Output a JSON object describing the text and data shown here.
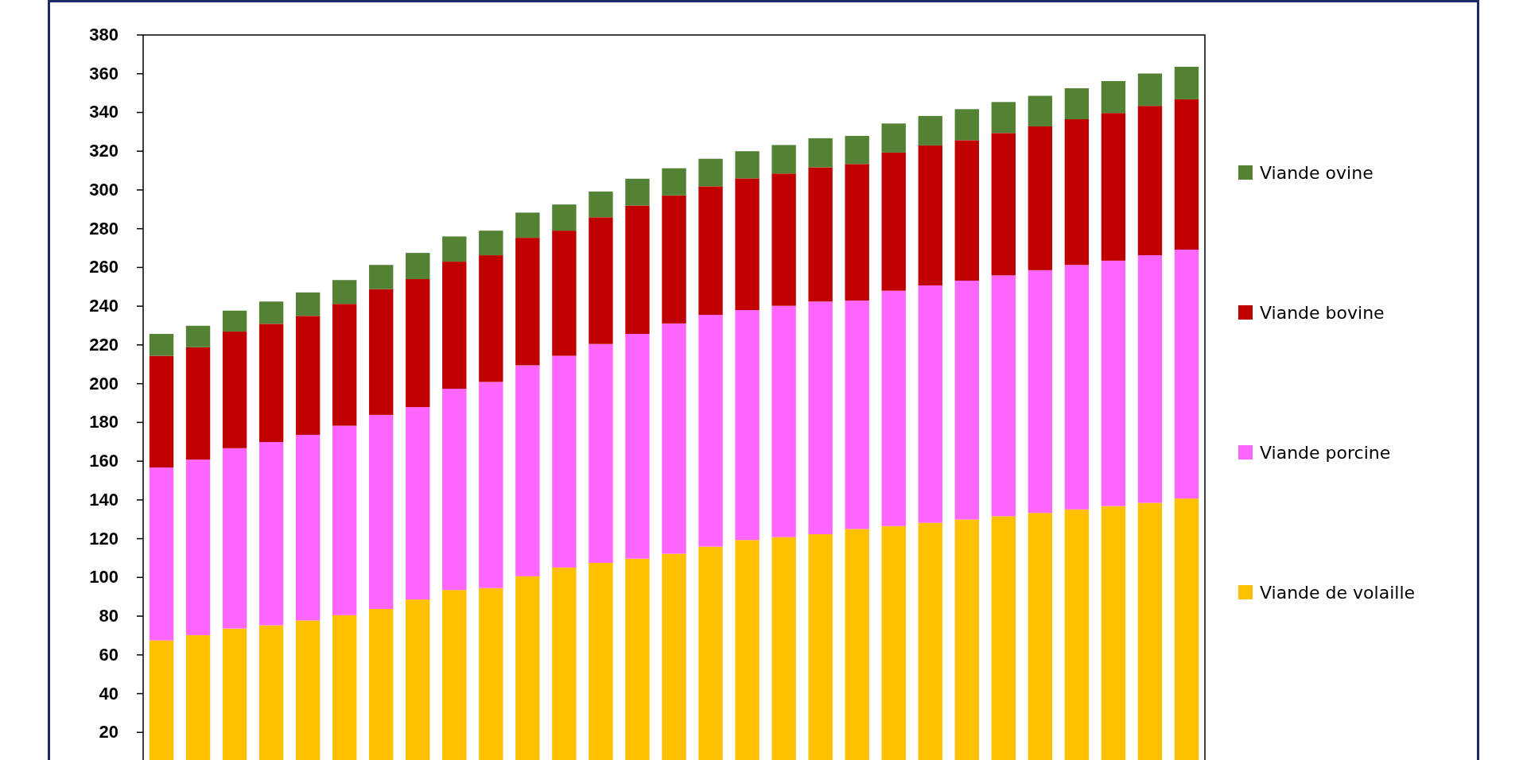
{
  "chart": {
    "chart_data": {
      "type": "bar",
      "stacked": true,
      "ylim": [
        0,
        380
      ],
      "yticks": [
        20,
        40,
        60,
        80,
        100,
        120,
        140,
        160,
        180,
        200,
        220,
        240,
        260,
        280,
        300,
        320,
        340,
        360,
        380
      ],
      "series": [
        {
          "name": "Viande de volaille",
          "color": "#ffc000",
          "values": [
            67.5,
            70.2,
            73.6,
            75.3,
            77.8,
            80.5,
            83.7,
            88.6,
            93.5,
            94.5,
            100.6,
            105.1,
            107.5,
            109.7,
            112.2,
            115.9,
            119.3,
            120.8,
            122.3,
            125.0,
            126.5,
            128.2,
            129.9,
            131.6,
            133.3,
            135.1,
            136.8,
            138.5,
            140.7
          ]
        },
        {
          "name": "Viande porcine",
          "color": "#ff66ff",
          "values": [
            89.2,
            90.6,
            93.1,
            94.6,
            95.8,
            97.8,
            100.2,
            99.3,
            103.9,
            106.4,
            108.9,
            109.3,
            113.0,
            116.0,
            118.9,
            119.6,
            118.7,
            119.4,
            120.1,
            117.9,
            121.5,
            122.5,
            123.3,
            124.3,
            125.3,
            126.2,
            126.7,
            127.8,
            128.5
          ]
        },
        {
          "name": "Viande bovine",
          "color": "#c00000",
          "values": [
            57.7,
            58.0,
            60.2,
            61.0,
            61.4,
            62.9,
            64.9,
            66.1,
            65.6,
            65.4,
            65.8,
            64.6,
            65.4,
            66.3,
            66.1,
            66.4,
            68.0,
            68.3,
            69.3,
            70.5,
            71.3,
            72.3,
            72.5,
            73.5,
            74.2,
            75.2,
            76.2,
            77.1,
            77.6
          ]
        },
        {
          "name": "Viande ovine",
          "color": "#548235",
          "values": [
            11.3,
            11.1,
            10.8,
            11.5,
            12.1,
            12.3,
            12.5,
            13.5,
            13.0,
            12.7,
            13.0,
            13.5,
            13.3,
            13.8,
            14.0,
            14.2,
            14.0,
            14.7,
            15.0,
            14.5,
            15.0,
            15.2,
            16.0,
            16.0,
            15.8,
            16.0,
            16.5,
            16.7,
            16.8
          ]
        }
      ]
    }
  }
}
